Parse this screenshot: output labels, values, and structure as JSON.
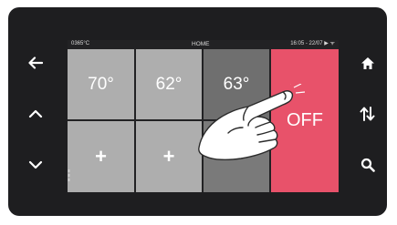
{
  "status": {
    "left": "0365°C",
    "center": "HOME",
    "right": "16:05 - 22/07 ▶ ᯤ"
  },
  "tiles": [
    {
      "label": "70°",
      "kind": "temp"
    },
    {
      "label": "62°",
      "kind": "temp"
    },
    {
      "label": "63°",
      "kind": "temp"
    },
    {
      "label": "OFF",
      "kind": "off"
    },
    {
      "label": "+",
      "kind": "add"
    },
    {
      "label": "+",
      "kind": "add"
    },
    {
      "label": "",
      "kind": "temp-dark"
    }
  ],
  "nav": {
    "left": [
      "back-arrow-icon",
      "chevron-up-icon",
      "chevron-down-icon"
    ],
    "right": [
      "home-icon",
      "swap-vertical-icon",
      "search-icon"
    ]
  },
  "colors": {
    "bezel": "#1e1e20",
    "tile_light": "#aeaeae",
    "tile_dark": "#6f6f6f",
    "off_red": "#e8526a"
  }
}
